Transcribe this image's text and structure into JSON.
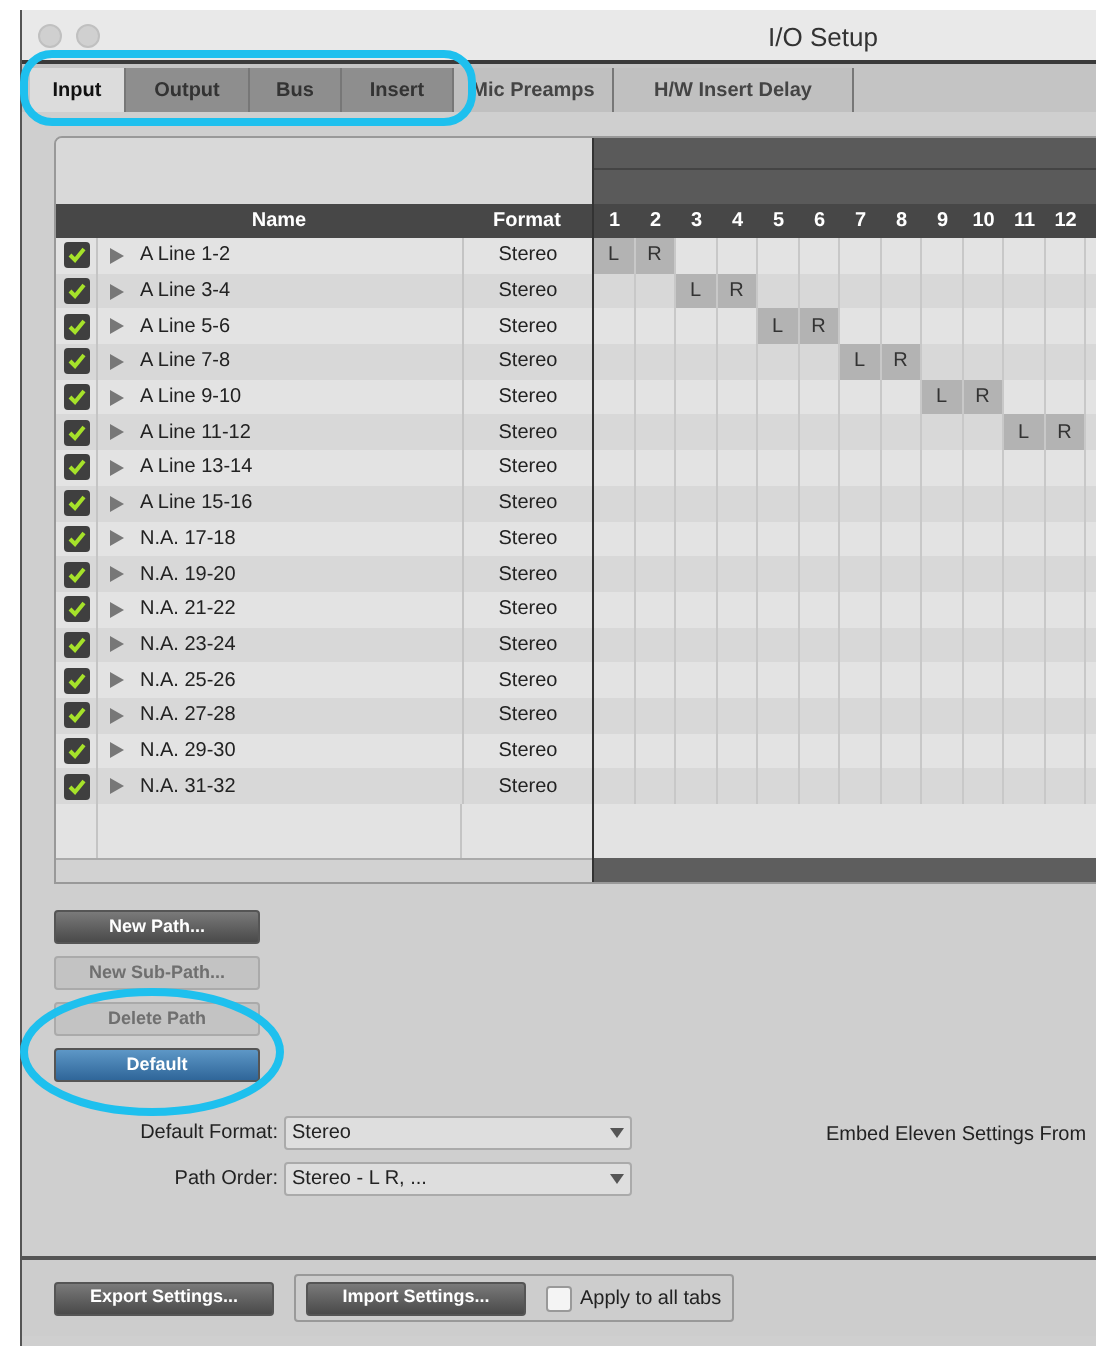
{
  "window": {
    "title": "I/O Setup"
  },
  "tabs": [
    {
      "label": "Input",
      "selected": true,
      "kind": "main"
    },
    {
      "label": "Output",
      "selected": false,
      "kind": "main"
    },
    {
      "label": "Bus",
      "selected": false,
      "kind": "main"
    },
    {
      "label": "Insert",
      "selected": false,
      "kind": "main"
    },
    {
      "label": "Mic Preamps",
      "selected": false,
      "kind": "extra"
    },
    {
      "label": "H/W Insert Delay",
      "selected": false,
      "kind": "extra"
    }
  ],
  "table": {
    "columns": [
      "Name",
      "Format"
    ],
    "channels": [
      "1",
      "2",
      "3",
      "4",
      "5",
      "6",
      "7",
      "8",
      "9",
      "10",
      "11",
      "12"
    ],
    "rows": [
      {
        "checked": true,
        "name": "A Line 1-2",
        "format": "Stereo",
        "cells": [
          {
            "kind": "assigned",
            "label": "L"
          },
          {
            "kind": "assigned",
            "label": "R"
          },
          {
            "kind": "empty"
          },
          {
            "kind": "empty"
          },
          {
            "kind": "empty"
          },
          {
            "kind": "empty"
          },
          {
            "kind": "empty"
          },
          {
            "kind": "empty"
          },
          {
            "kind": "empty"
          },
          {
            "kind": "empty"
          },
          {
            "kind": "empty"
          },
          {
            "kind": "empty"
          }
        ]
      },
      {
        "checked": true,
        "name": "A Line 3-4",
        "format": "Stereo",
        "cells": [
          {
            "kind": "empty"
          },
          {
            "kind": "empty"
          },
          {
            "kind": "assigned",
            "label": "L"
          },
          {
            "kind": "assigned",
            "label": "R"
          },
          {
            "kind": "empty"
          },
          {
            "kind": "empty"
          },
          {
            "kind": "empty"
          },
          {
            "kind": "empty"
          },
          {
            "kind": "empty"
          },
          {
            "kind": "empty"
          },
          {
            "kind": "empty"
          },
          {
            "kind": "empty"
          }
        ]
      },
      {
        "checked": true,
        "name": "A Line 5-6",
        "format": "Stereo",
        "cells": [
          {
            "kind": "empty"
          },
          {
            "kind": "empty"
          },
          {
            "kind": "empty"
          },
          {
            "kind": "empty"
          },
          {
            "kind": "assigned",
            "label": "L"
          },
          {
            "kind": "assigned",
            "label": "R"
          },
          {
            "kind": "empty"
          },
          {
            "kind": "empty"
          },
          {
            "kind": "empty"
          },
          {
            "kind": "empty"
          },
          {
            "kind": "empty"
          },
          {
            "kind": "empty"
          }
        ]
      },
      {
        "checked": true,
        "name": "A Line 7-8",
        "format": "Stereo",
        "cells": [
          {
            "kind": "empty"
          },
          {
            "kind": "empty"
          },
          {
            "kind": "empty"
          },
          {
            "kind": "empty"
          },
          {
            "kind": "empty"
          },
          {
            "kind": "empty"
          },
          {
            "kind": "assigned",
            "label": "L"
          },
          {
            "kind": "assigned",
            "label": "R"
          },
          {
            "kind": "empty"
          },
          {
            "kind": "empty"
          },
          {
            "kind": "empty"
          },
          {
            "kind": "empty"
          }
        ]
      },
      {
        "checked": true,
        "name": "A Line 9-10",
        "format": "Stereo",
        "cells": [
          {
            "kind": "empty"
          },
          {
            "kind": "empty"
          },
          {
            "kind": "empty"
          },
          {
            "kind": "empty"
          },
          {
            "kind": "empty"
          },
          {
            "kind": "empty"
          },
          {
            "kind": "empty"
          },
          {
            "kind": "empty"
          },
          {
            "kind": "assigned",
            "label": "L"
          },
          {
            "kind": "assigned",
            "label": "R"
          },
          {
            "kind": "empty"
          },
          {
            "kind": "empty"
          }
        ]
      },
      {
        "checked": true,
        "name": "A Line 11-12",
        "format": "Stereo",
        "cells": [
          {
            "kind": "empty"
          },
          {
            "kind": "empty"
          },
          {
            "kind": "empty"
          },
          {
            "kind": "empty"
          },
          {
            "kind": "empty"
          },
          {
            "kind": "empty"
          },
          {
            "kind": "empty"
          },
          {
            "kind": "empty"
          },
          {
            "kind": "empty"
          },
          {
            "kind": "empty"
          },
          {
            "kind": "assigned",
            "label": "L"
          },
          {
            "kind": "assigned",
            "label": "R"
          }
        ]
      },
      {
        "checked": true,
        "name": "A Line 13-14",
        "format": "Stereo",
        "cells": [
          {
            "kind": "empty"
          },
          {
            "kind": "empty"
          },
          {
            "kind": "empty"
          },
          {
            "kind": "empty"
          },
          {
            "kind": "empty"
          },
          {
            "kind": "empty"
          },
          {
            "kind": "empty"
          },
          {
            "kind": "empty"
          },
          {
            "kind": "empty"
          },
          {
            "kind": "empty"
          },
          {
            "kind": "empty"
          },
          {
            "kind": "empty"
          }
        ]
      },
      {
        "checked": true,
        "name": "A Line 15-16",
        "format": "Stereo",
        "cells": [
          {
            "kind": "empty"
          },
          {
            "kind": "empty"
          },
          {
            "kind": "empty"
          },
          {
            "kind": "empty"
          },
          {
            "kind": "empty"
          },
          {
            "kind": "empty"
          },
          {
            "kind": "empty"
          },
          {
            "kind": "empty"
          },
          {
            "kind": "empty"
          },
          {
            "kind": "empty"
          },
          {
            "kind": "empty"
          },
          {
            "kind": "empty"
          }
        ]
      },
      {
        "checked": true,
        "name": "N.A. 17-18",
        "format": "Stereo",
        "cells": [
          {
            "kind": "empty"
          },
          {
            "kind": "empty"
          },
          {
            "kind": "empty"
          },
          {
            "kind": "empty"
          },
          {
            "kind": "empty"
          },
          {
            "kind": "empty"
          },
          {
            "kind": "empty"
          },
          {
            "kind": "empty"
          },
          {
            "kind": "empty"
          },
          {
            "kind": "empty"
          },
          {
            "kind": "empty"
          },
          {
            "kind": "empty"
          }
        ]
      },
      {
        "checked": true,
        "name": "N.A. 19-20",
        "format": "Stereo",
        "cells": [
          {
            "kind": "empty"
          },
          {
            "kind": "empty"
          },
          {
            "kind": "empty"
          },
          {
            "kind": "empty"
          },
          {
            "kind": "empty"
          },
          {
            "kind": "empty"
          },
          {
            "kind": "empty"
          },
          {
            "kind": "empty"
          },
          {
            "kind": "empty"
          },
          {
            "kind": "empty"
          },
          {
            "kind": "empty"
          },
          {
            "kind": "empty"
          }
        ]
      },
      {
        "checked": true,
        "name": "N.A. 21-22",
        "format": "Stereo",
        "cells": [
          {
            "kind": "empty"
          },
          {
            "kind": "empty"
          },
          {
            "kind": "empty"
          },
          {
            "kind": "empty"
          },
          {
            "kind": "empty"
          },
          {
            "kind": "empty"
          },
          {
            "kind": "empty"
          },
          {
            "kind": "empty"
          },
          {
            "kind": "empty"
          },
          {
            "kind": "empty"
          },
          {
            "kind": "empty"
          },
          {
            "kind": "empty"
          }
        ]
      },
      {
        "checked": true,
        "name": "N.A. 23-24",
        "format": "Stereo",
        "cells": [
          {
            "kind": "empty"
          },
          {
            "kind": "empty"
          },
          {
            "kind": "empty"
          },
          {
            "kind": "empty"
          },
          {
            "kind": "empty"
          },
          {
            "kind": "empty"
          },
          {
            "kind": "empty"
          },
          {
            "kind": "empty"
          },
          {
            "kind": "empty"
          },
          {
            "kind": "empty"
          },
          {
            "kind": "empty"
          },
          {
            "kind": "empty"
          }
        ]
      },
      {
        "checked": true,
        "name": "N.A. 25-26",
        "format": "Stereo",
        "cells": [
          {
            "kind": "empty"
          },
          {
            "kind": "empty"
          },
          {
            "kind": "empty"
          },
          {
            "kind": "empty"
          },
          {
            "kind": "empty"
          },
          {
            "kind": "empty"
          },
          {
            "kind": "empty"
          },
          {
            "kind": "empty"
          },
          {
            "kind": "empty"
          },
          {
            "kind": "empty"
          },
          {
            "kind": "empty"
          },
          {
            "kind": "empty"
          }
        ]
      },
      {
        "checked": true,
        "name": "N.A. 27-28",
        "format": "Stereo",
        "cells": [
          {
            "kind": "empty"
          },
          {
            "kind": "empty"
          },
          {
            "kind": "empty"
          },
          {
            "kind": "empty"
          },
          {
            "kind": "empty"
          },
          {
            "kind": "empty"
          },
          {
            "kind": "empty"
          },
          {
            "kind": "empty"
          },
          {
            "kind": "empty"
          },
          {
            "kind": "empty"
          },
          {
            "kind": "empty"
          },
          {
            "kind": "empty"
          }
        ]
      },
      {
        "checked": true,
        "name": "N.A. 29-30",
        "format": "Stereo",
        "cells": [
          {
            "kind": "empty"
          },
          {
            "kind": "empty"
          },
          {
            "kind": "empty"
          },
          {
            "kind": "empty"
          },
          {
            "kind": "empty"
          },
          {
            "kind": "empty"
          },
          {
            "kind": "empty"
          },
          {
            "kind": "empty"
          },
          {
            "kind": "empty"
          },
          {
            "kind": "empty"
          },
          {
            "kind": "empty"
          },
          {
            "kind": "empty"
          }
        ]
      },
      {
        "checked": true,
        "name": "N.A. 31-32",
        "format": "Stereo",
        "cells": [
          {
            "kind": "empty"
          },
          {
            "kind": "empty"
          },
          {
            "kind": "empty"
          },
          {
            "kind": "empty"
          },
          {
            "kind": "empty"
          },
          {
            "kind": "empty"
          },
          {
            "kind": "empty"
          },
          {
            "kind": "empty"
          },
          {
            "kind": "empty"
          },
          {
            "kind": "empty"
          },
          {
            "kind": "empty"
          },
          {
            "kind": "empty"
          }
        ]
      }
    ]
  },
  "path_buttons": [
    {
      "label": "New Path...",
      "disabled": false,
      "kind": "normal"
    },
    {
      "label": "New Sub-Path...",
      "disabled": true,
      "kind": "normal"
    },
    {
      "label": "Delete Path",
      "disabled": true,
      "kind": "normal"
    },
    {
      "label": "Default",
      "disabled": false,
      "kind": "primary"
    }
  ],
  "settings": [
    {
      "label": "Default Format:",
      "value": "Stereo"
    },
    {
      "label": "Path Order:",
      "value": "Stereo - L R, ..."
    }
  ],
  "embed_label": "Embed Eleven Settings From",
  "footer": {
    "export": "Export Settings...",
    "import": "Import Settings...",
    "apply_all": {
      "label": "Apply to all tabs",
      "checked": false
    }
  }
}
